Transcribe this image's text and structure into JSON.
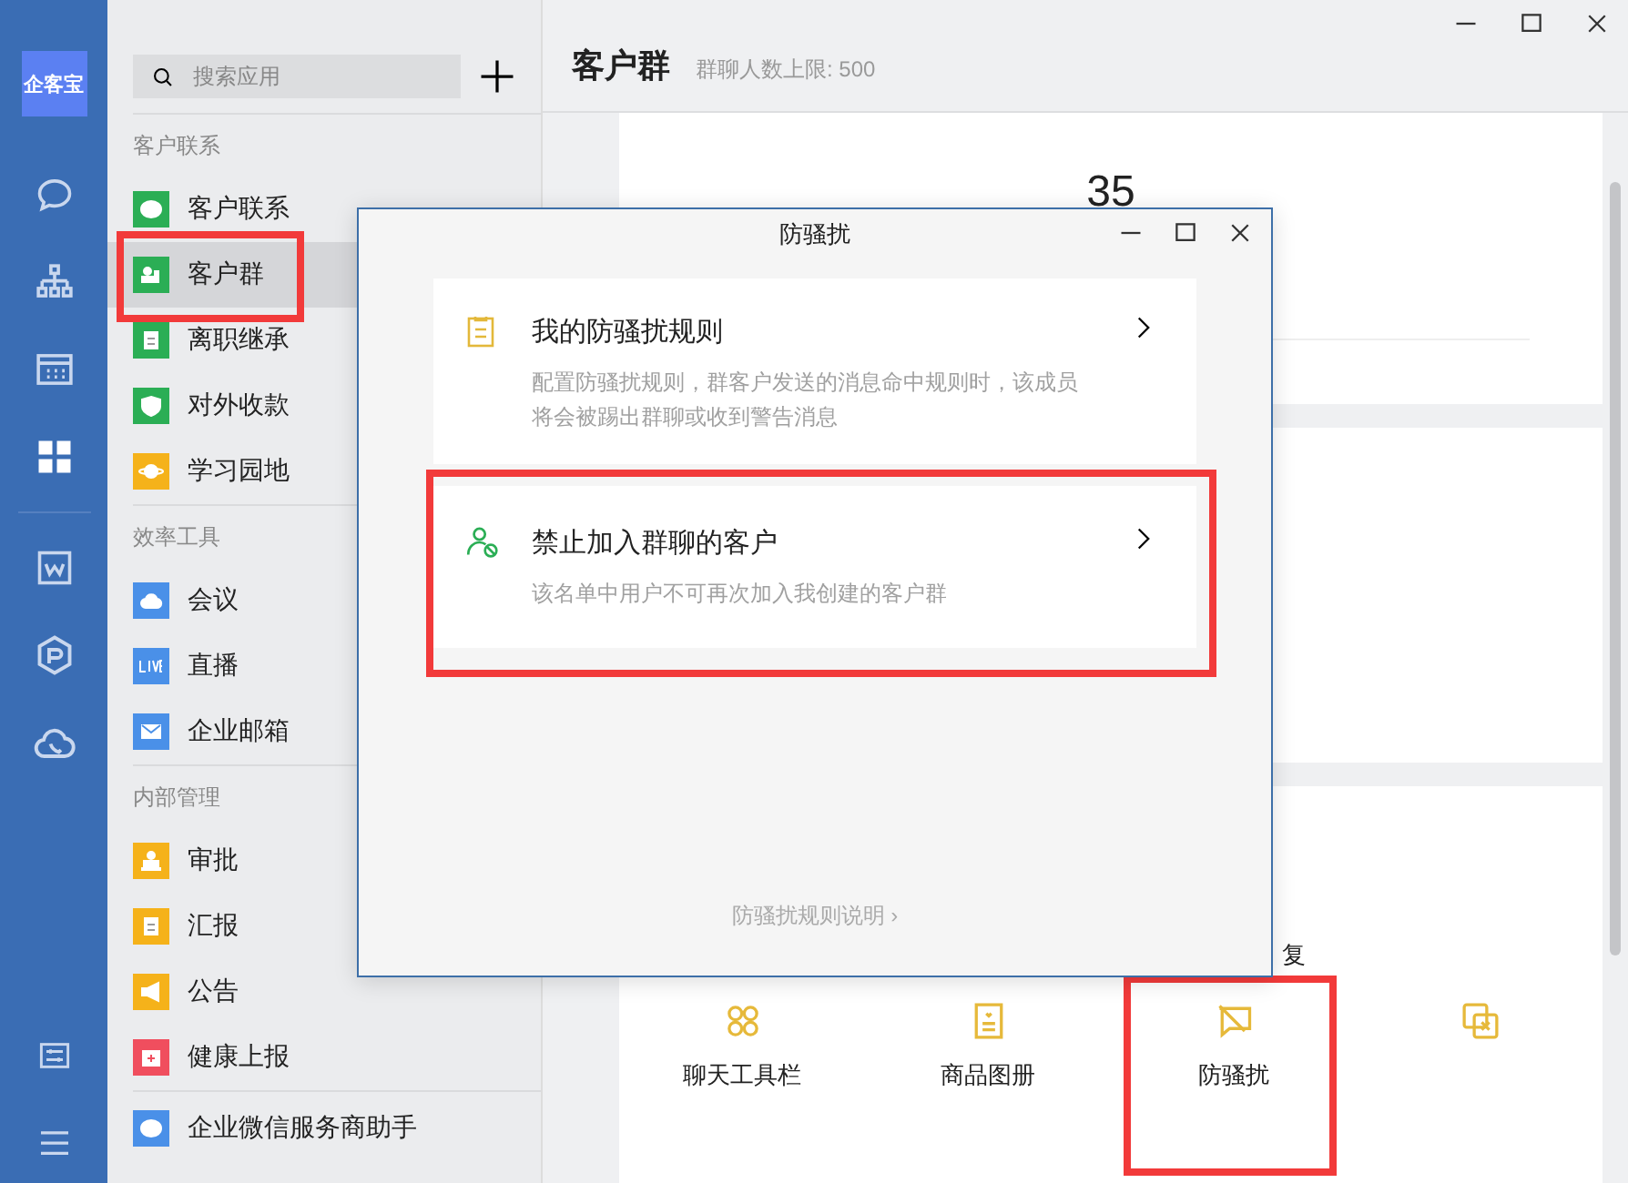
{
  "rail": {
    "logo": "企客宝",
    "items": [
      {
        "kind": "chat",
        "selected": false
      },
      {
        "kind": "org",
        "selected": false
      },
      {
        "kind": "calendar",
        "selected": false
      },
      {
        "kind": "apps",
        "selected": true
      },
      {
        "kind": "doc",
        "selected": false
      },
      {
        "kind": "hexagon",
        "selected": false
      },
      {
        "kind": "cloud",
        "selected": false
      }
    ],
    "bottom": [
      {
        "kind": "sliders"
      },
      {
        "kind": "menu"
      }
    ]
  },
  "sidebar": {
    "search": {
      "placeholder": "搜索应用"
    },
    "sections": [
      {
        "title": "客户联系",
        "items": [
          {
            "label": "客户联系",
            "kind": "bubble",
            "color": "#2bae55",
            "selected": false,
            "highlighted": false
          },
          {
            "label": "客户群",
            "kind": "people",
            "color": "#2bae55",
            "selected": true,
            "highlighted": true
          },
          {
            "label": "离职继承",
            "kind": "list",
            "color": "#2bae55",
            "selected": false,
            "highlighted": false
          },
          {
            "label": "对外收款",
            "kind": "shield",
            "color": "#2bae55",
            "selected": false,
            "highlighted": false
          },
          {
            "label": "学习园地",
            "kind": "planet",
            "color": "#f5b21a",
            "selected": false,
            "highlighted": false
          }
        ]
      },
      {
        "title": "效率工具",
        "items": [
          {
            "label": "会议",
            "kind": "cloud",
            "color": "#4a90e8",
            "selected": false,
            "highlighted": false
          },
          {
            "label": "直播",
            "kind": "live",
            "color": "#4a90e8",
            "selected": false,
            "highlighted": false
          },
          {
            "label": "企业邮箱",
            "kind": "mail",
            "color": "#4a90e8",
            "selected": false,
            "highlighted": false
          }
        ]
      },
      {
        "title": "内部管理",
        "items": [
          {
            "label": "审批",
            "kind": "stamp",
            "color": "#f5b21a",
            "selected": false,
            "highlighted": false
          },
          {
            "label": "汇报",
            "kind": "list",
            "color": "#f5b21a",
            "selected": false,
            "highlighted": false
          },
          {
            "label": "公告",
            "kind": "horn",
            "color": "#f5b21a",
            "selected": false,
            "highlighted": false
          },
          {
            "label": "健康上报",
            "kind": "kit",
            "color": "#f04e5e",
            "selected": false,
            "highlighted": false
          }
        ]
      },
      {
        "items": [
          {
            "label": "企业微信服务商助手",
            "kind": "bubble",
            "color": "#4a90e8",
            "selected": false,
            "highlighted": false
          }
        ]
      }
    ]
  },
  "main": {
    "title": "客户群",
    "subtitle": "群聊人数上限: 500",
    "count": "35",
    "partial_label": "复",
    "tools": [
      {
        "label": "聊天工具栏",
        "kind": "cross",
        "highlighted": false
      },
      {
        "label": "商品图册",
        "kind": "catalog",
        "highlighted": false
      },
      {
        "label": "防骚扰",
        "kind": "chat-slash",
        "highlighted": true
      },
      {
        "kind": "copy-x",
        "highlighted": false
      }
    ]
  },
  "dialog": {
    "title": "防骚扰",
    "options": [
      {
        "title": "我的防骚扰规则",
        "description": "配置防骚扰规则，群客户发送的消息命中规则时，该成员将会被踢出群聊或收到警告消息",
        "kind": "note",
        "highlighted": false
      },
      {
        "title": "禁止加入群聊的客户",
        "description": "该名单中用户不可再次加入我创建的客户群",
        "kind": "user-block",
        "highlighted": true
      }
    ],
    "footer_link": "防骚扰规则说明 ›"
  }
}
